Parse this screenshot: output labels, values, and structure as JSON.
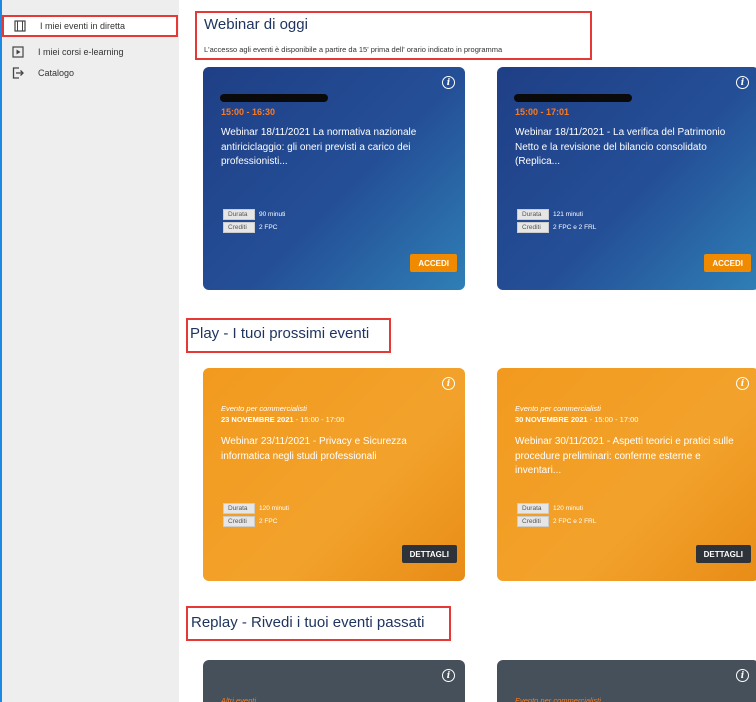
{
  "sidebar": {
    "items": [
      {
        "label": "I miei eventi in diretta",
        "icon": "film-icon"
      },
      {
        "label": "I miei corsi e-learning",
        "icon": "play-box-icon"
      },
      {
        "label": "Catalogo",
        "icon": "logout-icon"
      }
    ]
  },
  "sections": {
    "live": {
      "title": "Webinar di oggi",
      "subtitle": "L'accesso agli eventi è disponibile a partire da 15' prima dell' orario indicato in programma"
    },
    "play": {
      "title": "Play - I tuoi prossimi eventi"
    },
    "replay": {
      "title": "Replay - Rivedi i tuoi eventi passati"
    }
  },
  "live_cards": [
    {
      "time": "15:00 - 16:30",
      "title": "Webinar 18/11/2021 La normativa nazionale antiriciclaggio: gli oneri previsti a carico dei professionisti...",
      "durata_label": "Durata",
      "durata": "90 minuti",
      "crediti_label": "Crediti",
      "crediti": "2 FPC",
      "button": "ACCEDI"
    },
    {
      "time": "15:00 - 17:01",
      "title": "Webinar 18/11/2021 - La verifica del Patrimonio Netto e la revisione del bilancio consolidato (Replica...",
      "durata_label": "Durata",
      "durata": "121 minuti",
      "crediti_label": "Crediti",
      "crediti": "2 FPC e 2 FRL",
      "button": "ACCEDI"
    }
  ],
  "play_cards": [
    {
      "type": "Evento per commercialisti",
      "date": "23 NOVEMBRE 2021",
      "time": " - 15:00 - 17:00",
      "title": "Webinar 23/11/2021 - Privacy e Sicurezza informatica negli studi professionali",
      "durata_label": "Durata",
      "durata": "120 minuti",
      "crediti_label": "Crediti",
      "crediti": "2 FPC",
      "button": "DETTAGLI"
    },
    {
      "type": "Evento per commercialisti",
      "date": "30 NOVEMBRE 2021",
      "time": " - 15:00 - 17:00",
      "title": "Webinar 30/11/2021 - Aspetti teorici e pratici sulle procedure preliminari: conferme esterne e inventari...",
      "durata_label": "Durata",
      "durata": "120 minuti",
      "crediti_label": "Crediti",
      "crediti": "2 FPC e 2 FRL",
      "button": "DETTAGLI"
    }
  ],
  "replay_cards": [
    {
      "type": "Altri eventi"
    },
    {
      "type": "Evento per commercialisti"
    }
  ],
  "colors": {
    "accent_red": "#e53935",
    "title_blue": "#1f3560",
    "button_orange": "#f08a00"
  }
}
